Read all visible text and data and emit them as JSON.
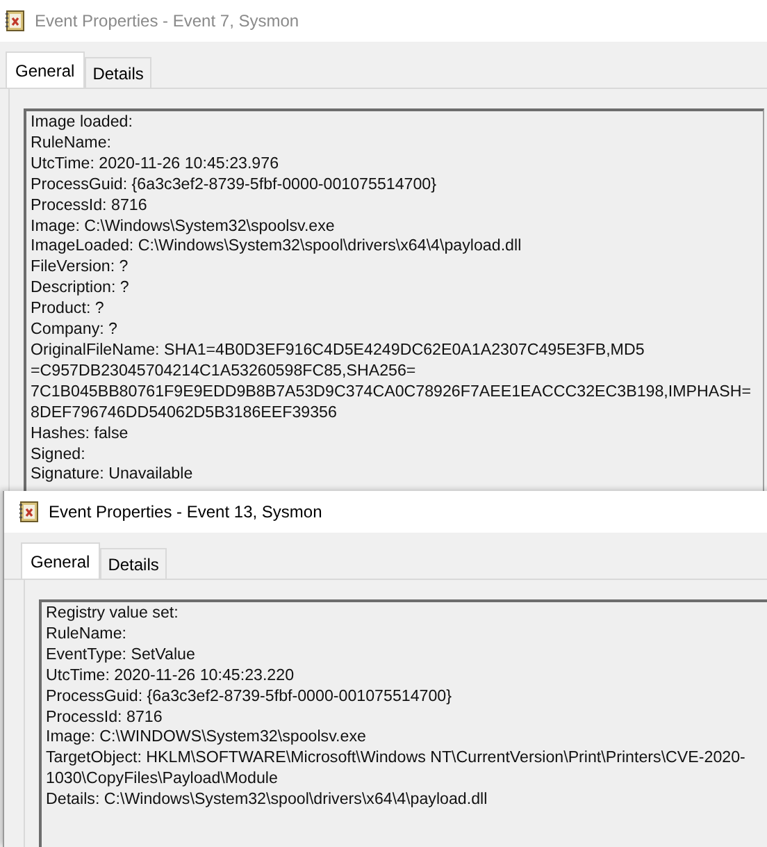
{
  "windows": [
    {
      "title": "Event Properties - Event 7, Sysmon",
      "tabs": [
        {
          "label": "General",
          "selected": true
        },
        {
          "label": "Details",
          "selected": false
        }
      ],
      "lines": [
        "Image loaded:",
        "RuleName:",
        "UtcTime: 2020-11-26 10:45:23.976",
        "ProcessGuid: {6a3c3ef2-8739-5fbf-0000-001075514700}",
        "ProcessId: 8716",
        "Image: C:\\Windows\\System32\\spoolsv.exe",
        "ImageLoaded: C:\\Windows\\System32\\spool\\drivers\\x64\\4\\payload.dll",
        "FileVersion: ?",
        "Description: ?",
        "Product: ?",
        "Company: ?",
        "OriginalFileName: SHA1=4B0D3EF916C4D5E4249DC62E0A1A2307C495E3FB,MD5",
        "=C957DB23045704214C1A53260598FC85,SHA256=",
        "7C1B045BB80761F9E9EDD9B8B7A53D9C374CA0C78926F7AEE1EACCC32EC3B198,IMPHASH=",
        "8DEF796746DD54062D5B3186EEF39356",
        "Hashes: false",
        "Signed:",
        "Signature: Unavailable"
      ]
    },
    {
      "title": "Event Properties - Event 13, Sysmon",
      "tabs": [
        {
          "label": "General",
          "selected": true
        },
        {
          "label": "Details",
          "selected": false
        }
      ],
      "lines": [
        "Registry value set:",
        "RuleName:",
        "EventType: SetValue",
        "UtcTime: 2020-11-26 10:45:23.220",
        "ProcessGuid: {6a3c3ef2-8739-5fbf-0000-001075514700}",
        "ProcessId: 8716",
        "Image: C:\\WINDOWS\\System32\\spoolsv.exe",
        "TargetObject: HKLM\\SOFTWARE\\Microsoft\\Windows NT\\CurrentVersion\\Print\\Printers\\CVE-2020-",
        "1030\\CopyFiles\\Payload\\Module",
        "Details: C:\\Windows\\System32\\spool\\drivers\\x64\\4\\payload.dll"
      ]
    }
  ]
}
